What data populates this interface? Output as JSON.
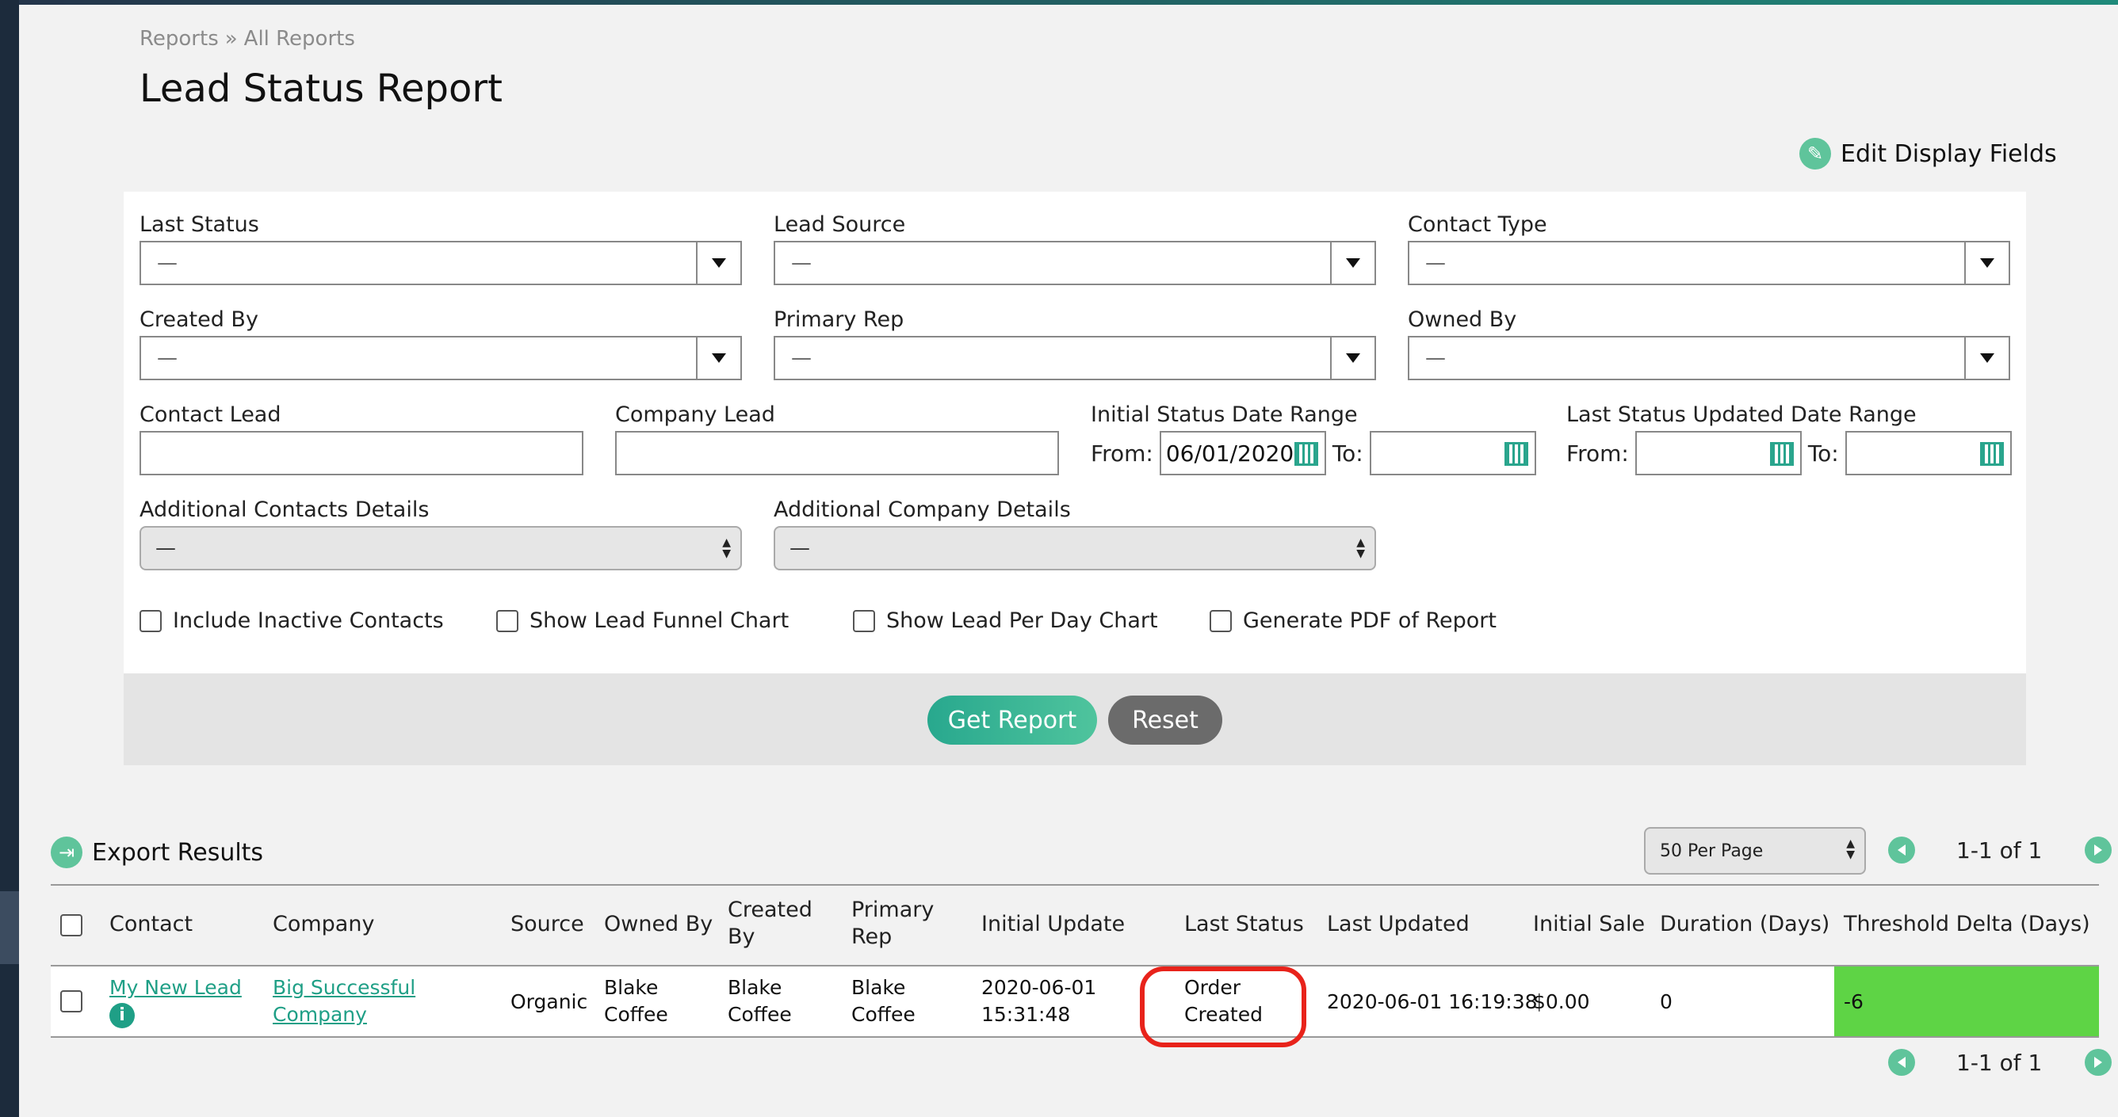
{
  "breadcrumb": {
    "parent": "Reports",
    "separator": "»",
    "current": "All Reports"
  },
  "page_title": "Lead Status Report",
  "edit_display_fields": "Edit Display Fields",
  "filters": {
    "last_status": {
      "label": "Last Status",
      "value": "—"
    },
    "lead_source": {
      "label": "Lead Source",
      "value": "—"
    },
    "contact_type": {
      "label": "Contact Type",
      "value": "—"
    },
    "created_by": {
      "label": "Created By",
      "value": "—"
    },
    "primary_rep": {
      "label": "Primary Rep",
      "value": "—"
    },
    "owned_by": {
      "label": "Owned By",
      "value": "—"
    },
    "contact_lead": {
      "label": "Contact Lead",
      "value": ""
    },
    "company_lead": {
      "label": "Company Lead",
      "value": ""
    },
    "initial_status_date_range": {
      "label": "Initial Status Date Range",
      "from_label": "From:",
      "from_value": "06/01/2020",
      "to_label": "To:",
      "to_value": ""
    },
    "last_status_updated_date_range": {
      "label": "Last Status Updated Date Range",
      "from_label": "From:",
      "from_value": "",
      "to_label": "To:",
      "to_value": ""
    },
    "additional_contacts_details": {
      "label": "Additional Contacts Details",
      "value": "—"
    },
    "additional_company_details": {
      "label": "Additional Company Details",
      "value": "—"
    }
  },
  "checkboxes": {
    "include_inactive": "Include Inactive Contacts",
    "lead_funnel": "Show Lead Funnel Chart",
    "lead_per_day": "Show Lead Per Day Chart",
    "generate_pdf": "Generate PDF of Report"
  },
  "buttons": {
    "get_report": "Get Report",
    "reset": "Reset"
  },
  "export_results": "Export Results",
  "per_page": "50 Per Page",
  "pagination": "1-1 of 1",
  "table": {
    "headers": {
      "contact": "Contact",
      "company": "Company",
      "source": "Source",
      "owned_by": "Owned By",
      "created_by_1": "Created",
      "created_by_2": "By",
      "primary_rep_1": "Primary",
      "primary_rep_2": "Rep",
      "initial_update": "Initial Update",
      "last_status": "Last Status",
      "last_updated": "Last Updated",
      "initial_sale": "Initial Sale",
      "duration": "Duration (Days)",
      "threshold": "Threshold Delta (Days)"
    },
    "row": {
      "contact": "My New Lead",
      "company_1": "Big Successful",
      "company_2": "Company",
      "source": "Organic",
      "owned_by_1": "Blake",
      "owned_by_2": "Coffee",
      "created_by_1": "Blake",
      "created_by_2": "Coffee",
      "primary_rep_1": "Blake",
      "primary_rep_2": "Coffee",
      "initial_update_1": "2020-06-01",
      "initial_update_2": "15:31:48",
      "last_status_1": "Order",
      "last_status_2": "Created",
      "last_updated": "2020-06-01 16:19:38",
      "initial_sale": "$0.00",
      "duration": "0",
      "threshold": "-6"
    }
  },
  "colors": {
    "accent": "#1f9f86",
    "threshold_cell": "#5ed445",
    "highlight_ring": "#e8231b"
  }
}
